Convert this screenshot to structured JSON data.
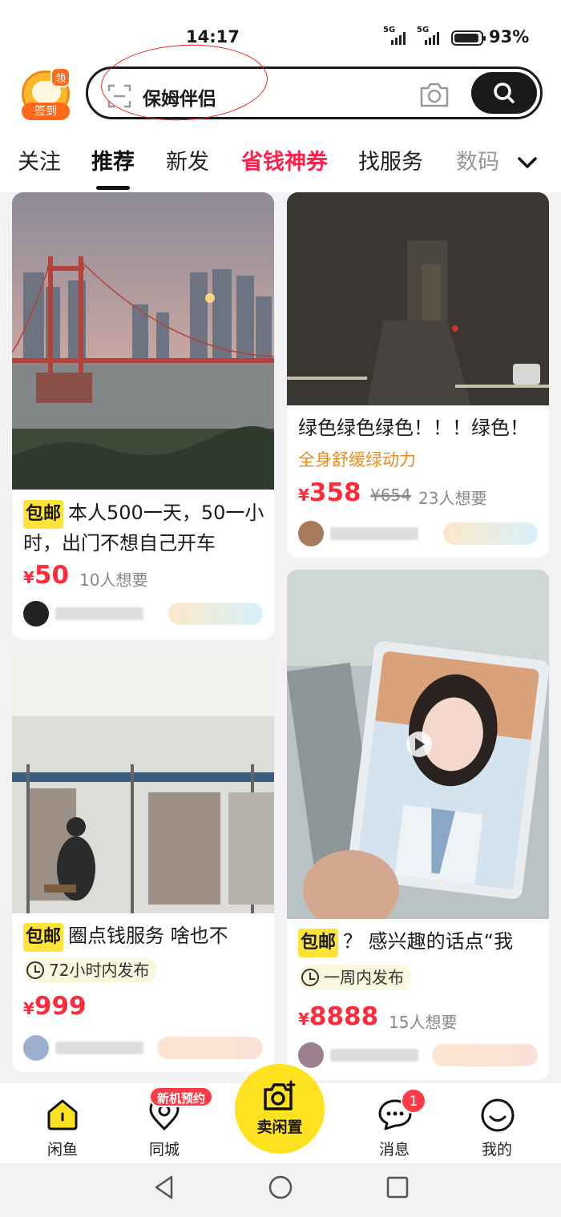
{
  "status": {
    "time": "14:17",
    "sig1": "5G",
    "sig2": "5G",
    "battery": "93%"
  },
  "header": {
    "signin_tag": "领",
    "signin_label": "签到",
    "search_query": "保姆伴侣"
  },
  "tabs": [
    {
      "label": "关注"
    },
    {
      "label": "推荐"
    },
    {
      "label": "新发"
    },
    {
      "label": "省钱神券"
    },
    {
      "label": "找服务"
    },
    {
      "label": "数码"
    }
  ],
  "cards": {
    "c1": {
      "tag": "包邮",
      "title": "本人500一天，50一小时，出门不想自己开车",
      "price_symbol": "¥",
      "price": "50",
      "want": "10人想要"
    },
    "c2": {
      "title": "绿色绿色绿色！！！绿色！",
      "subtitle": "全身舒缓绿动力",
      "price_symbol": "¥",
      "price": "358",
      "orig": "¥654",
      "want": "23人想要"
    },
    "c3": {
      "tag": "包邮",
      "title": "圈点钱服务 啥也不",
      "time": "72小时内发布",
      "price_symbol": "¥",
      "price": "999"
    },
    "c4": {
      "tag": "包邮",
      "title": "？ 感兴趣的话点“我",
      "time": "一周内发布",
      "price_symbol": "¥",
      "price": "8888",
      "want": "15人想要"
    }
  },
  "nav": {
    "home": "闲鱼",
    "city": "同城",
    "city_promo": "新机预约",
    "sell": "卖闲置",
    "msg": "消息",
    "msg_badge": "1",
    "me": "我的"
  },
  "colors": {
    "accent": "#ffe21f",
    "price": "#ff2a3a",
    "promo_tab": "#ff1f4a"
  }
}
